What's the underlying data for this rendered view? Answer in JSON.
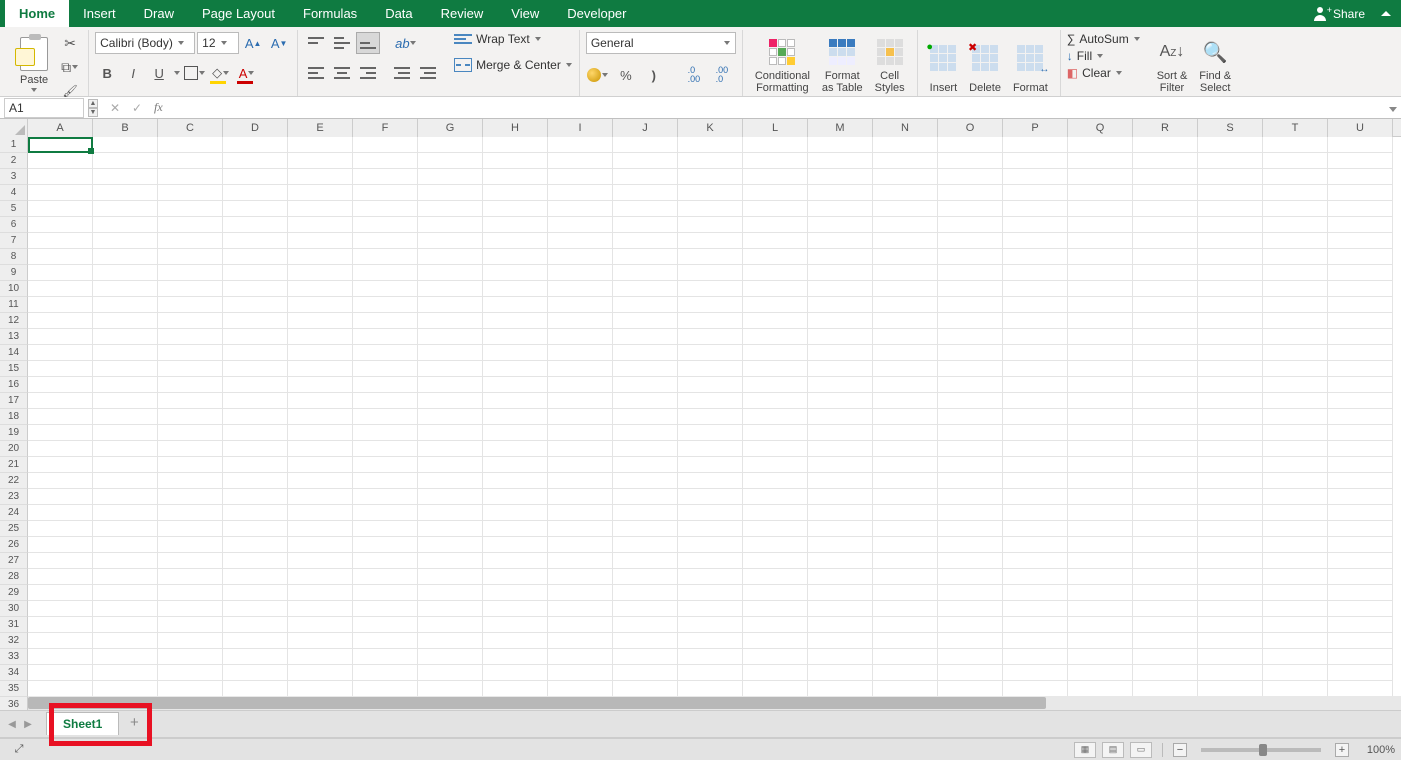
{
  "tabs": {
    "items": [
      "Home",
      "Insert",
      "Draw",
      "Page Layout",
      "Formulas",
      "Data",
      "Review",
      "View",
      "Developer"
    ],
    "active": "Home",
    "share": "Share"
  },
  "clipboard": {
    "paste": "Paste"
  },
  "font": {
    "name": "Calibri (Body)",
    "size": "12",
    "bold": "B",
    "italic": "I",
    "underline": "U"
  },
  "alignment": {
    "wrap": "Wrap Text",
    "merge": "Merge & Center"
  },
  "number": {
    "format": "General",
    "percent": "%",
    "comma": ","
  },
  "styles": {
    "conditional": "Conditional\nFormatting",
    "as_table": "Format\nas Table",
    "cell_styles": "Cell\nStyles"
  },
  "cells": {
    "insert": "Insert",
    "delete": "Delete",
    "format": "Format"
  },
  "editing": {
    "autosum": "AutoSum",
    "fill": "Fill",
    "clear": "Clear",
    "sort": "Sort &\nFilter",
    "find": "Find &\nSelect"
  },
  "formula_bar": {
    "name_box": "A1",
    "fx": "fx",
    "value": ""
  },
  "grid": {
    "columns": [
      "A",
      "B",
      "C",
      "D",
      "E",
      "F",
      "G",
      "H",
      "I",
      "J",
      "K",
      "L",
      "M",
      "N",
      "O",
      "P",
      "Q",
      "R",
      "S",
      "T",
      "U"
    ],
    "rows": 36
  },
  "sheet": {
    "name": "Sheet1",
    "add": "+",
    "nav_prev": "◀",
    "nav_next": "▶"
  },
  "status": {
    "zoom": "100%",
    "minus": "−",
    "plus": "+"
  }
}
